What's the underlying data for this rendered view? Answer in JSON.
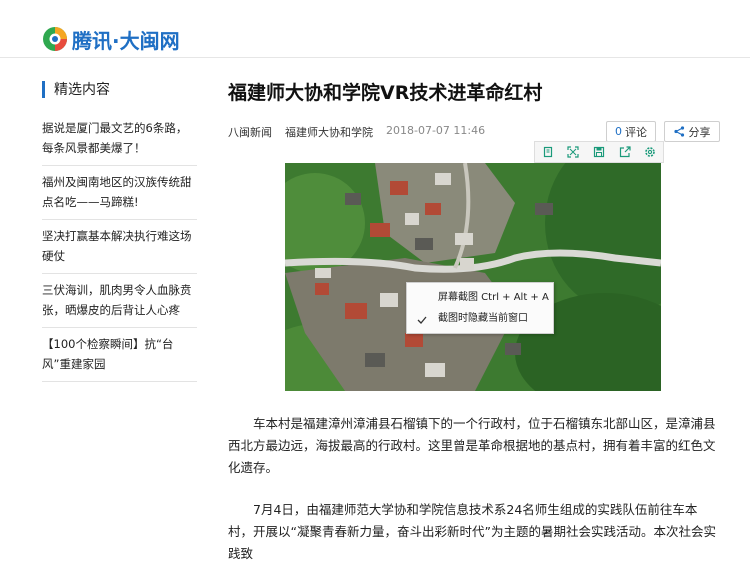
{
  "site": {
    "logo_text": "腾讯·大闽网",
    "logo_icon": "tencent-logo-icon"
  },
  "sidebar": {
    "title": "精选内容",
    "items": [
      {
        "label": "据说是厦门最文艺的6条路，每条风景都美爆了！"
      },
      {
        "label": "福州及闽南地区的汉族传统甜点名吃——马蹄糕!"
      },
      {
        "label": "坚决打赢基本解决执行难这场硬仗"
      },
      {
        "label": "三伏海训，肌肉男令人血脉贲张，晒爆皮的后背让人心疼"
      },
      {
        "label": "【100个检察瞬间】抗“台风”重建家园"
      }
    ]
  },
  "article": {
    "title": "福建师大协和学院VR技术进革命红村",
    "source": "八闽新闻",
    "author": "福建师大协和学院",
    "date": "2018-07-07 11:46",
    "comment_count": "0",
    "comment_label": "评论",
    "share_label": "分享",
    "paragraphs": [
      "车本村是福建漳州漳浦县石榴镇下的一个行政村，位于石榴镇东北部山区，是漳浦县西北方最边远，海拔最高的行政村。这里曾是革命根据地的基点村，拥有着丰富的红色文化遗存。",
      "7月4日，由福建师范大学协和学院信息技术系24名师生组成的实践队伍前往车本村，开展以“凝聚青春新力量，奋斗出彩新时代”为主题的暑期社会实践活动。本次社会实践致"
    ]
  },
  "image_toolbar": {
    "icons": [
      "copy-icon",
      "fullscreen-icon",
      "save-icon",
      "export-icon",
      "settings-icon"
    ]
  },
  "context_menu": {
    "items": [
      {
        "label": "屏幕截图 Ctrl + Alt + A"
      },
      {
        "label": "截图时隐藏当前窗口",
        "checked": true
      }
    ]
  },
  "colors": {
    "accent": "#1f6fc4",
    "text": "#222222",
    "muted": "#888888"
  }
}
